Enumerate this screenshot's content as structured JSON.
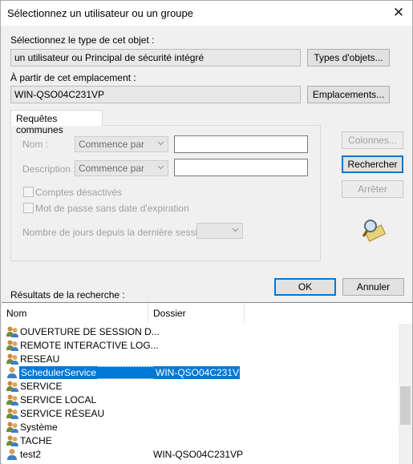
{
  "window": {
    "title": "Sélectionnez un utilisateur ou un groupe",
    "close_glyph": "✕"
  },
  "object_type": {
    "label": "Sélectionnez le type de cet objet :",
    "value": "un utilisateur ou Principal de sécurité intégré",
    "button": "Types d'objets..."
  },
  "location": {
    "label": "À partir de cet emplacement :",
    "value": "WIN-QSO04C231VP",
    "button": "Emplacements..."
  },
  "tab": {
    "label": "Requêtes communes"
  },
  "query": {
    "name_label": "Nom :",
    "name_mode": "Commence par",
    "name_value": "",
    "desc_label": "Description :",
    "desc_mode": "Commence par",
    "desc_value": "",
    "disabled_accounts": "Comptes désactivés",
    "no_expire_password": "Mot de passe sans date d'expiration",
    "days_label": "Nombre de jours depuis la dernière session :",
    "days_value": ""
  },
  "side_buttons": {
    "columns": "Colonnes...",
    "search": "Rechercher",
    "stop": "Arrêter"
  },
  "actions": {
    "ok": "OK",
    "cancel": "Annuler"
  },
  "results": {
    "label": "Résultats de la recherche :",
    "col_name": "Nom",
    "col_folder": "Dossier",
    "rows": [
      {
        "name": "OUVERTURE DE SESSION D...",
        "folder": "",
        "icon": "group-icon"
      },
      {
        "name": "REMOTE INTERACTIVE LOG...",
        "folder": "",
        "icon": "group-icon"
      },
      {
        "name": "RESEAU",
        "folder": "",
        "icon": "group-icon"
      },
      {
        "name": "SchedulerService",
        "folder": "WIN-QSO04C231VP",
        "icon": "user-icon"
      },
      {
        "name": "SERVICE",
        "folder": "",
        "icon": "group-icon"
      },
      {
        "name": "SERVICE LOCAL",
        "folder": "",
        "icon": "group-icon"
      },
      {
        "name": "SERVICE RÉSEAU",
        "folder": "",
        "icon": "group-icon"
      },
      {
        "name": "Système",
        "folder": "",
        "icon": "group-icon"
      },
      {
        "name": "TACHE",
        "folder": "",
        "icon": "group-icon"
      },
      {
        "name": "test2",
        "folder": "WIN-QSO04C231VP",
        "icon": "user-icon"
      }
    ],
    "selected_index": 3
  },
  "colors": {
    "selection": "#0078d7",
    "dialog_bg": "#f0f0f0",
    "disabled_text": "#a0a0a0"
  }
}
